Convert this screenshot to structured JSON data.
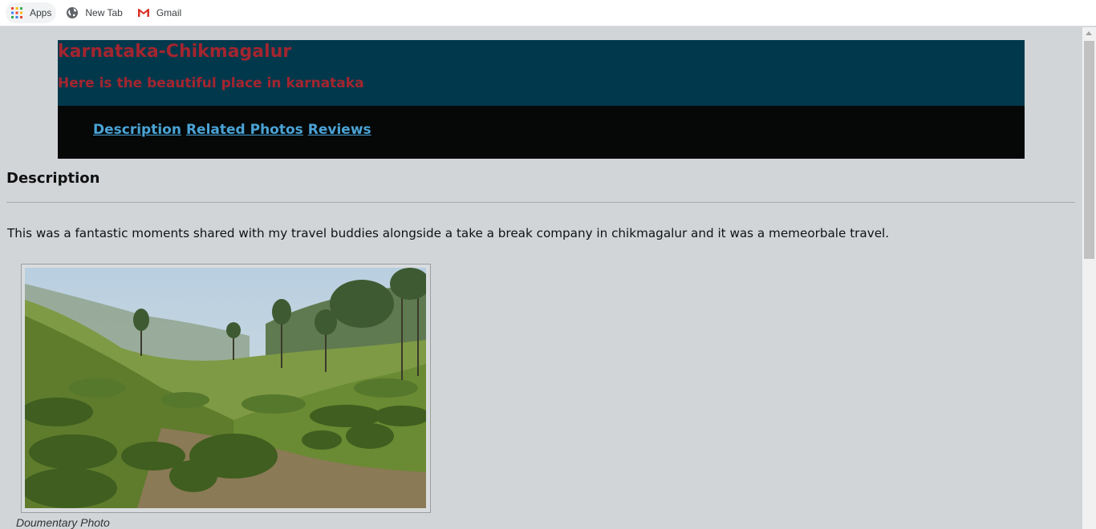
{
  "bookmarks": {
    "apps": "Apps",
    "new_tab": "New Tab",
    "gmail": "Gmail"
  },
  "header": {
    "title": "karnataka-Chikmagalur",
    "subtitle": "Here is the beautiful place in karnataka"
  },
  "nav": {
    "items": [
      "Description",
      "Related Photos",
      "Reviews"
    ]
  },
  "content": {
    "section_heading": "Description",
    "description": "This was a fantastic moments shared with my travel buddies alongside a take a break company in chikmagalur and it was a memeorbale travel.",
    "photo_caption": "Doumentary Photo"
  },
  "colors": {
    "page_bg": "#d1d5d8",
    "header_bg": "#01384c",
    "nav_bg": "#050807",
    "title_color": "#a3252f",
    "link_color": "#4aa3d6"
  },
  "icons": [
    "apps-grid-icon",
    "globe-icon",
    "gmail-icon"
  ]
}
